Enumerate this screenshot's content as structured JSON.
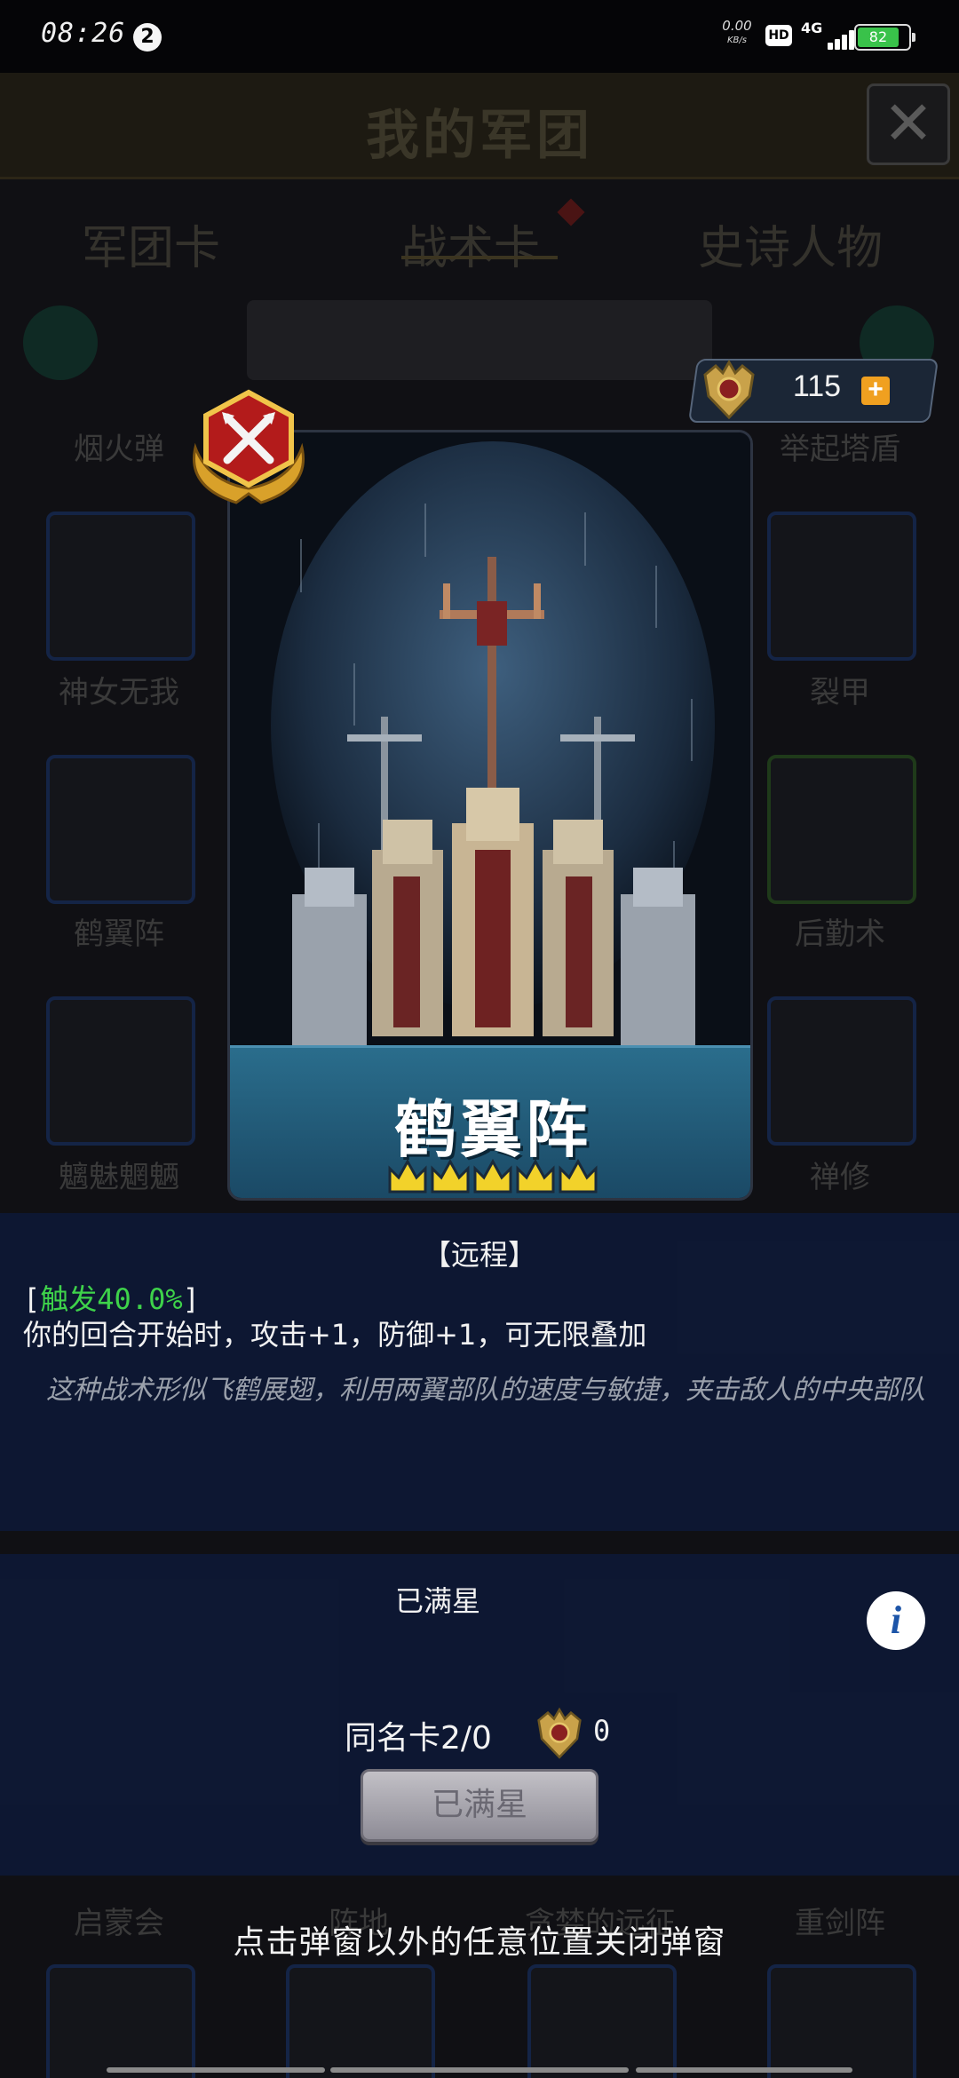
{
  "status_bar": {
    "time": "08:26",
    "notification_count": "2",
    "net_speed": "0.00",
    "net_speed_unit": "KB/s",
    "hd": "HD",
    "network": "4G",
    "battery": "82"
  },
  "background": {
    "title": "我的军团",
    "tabs": [
      "军团卡",
      "战术卡",
      "史诗人物"
    ],
    "cards": {
      "left": [
        "烟火弹",
        "神女无我",
        "鹤翼阵",
        "魑魅魍魉",
        "启蒙会"
      ],
      "right": [
        "举起塔盾",
        "裂甲",
        "后勤术",
        "禅修",
        "重剑阵"
      ],
      "middle": [
        "阵地",
        "贪婪的远征"
      ]
    }
  },
  "currency": {
    "value": "115",
    "plus": "+"
  },
  "card": {
    "name": "鹤翼阵",
    "stars": 5
  },
  "info": {
    "type": "【远程】",
    "trigger_open": "[",
    "trigger_text": "触发40.0%",
    "trigger_close": "]",
    "effect": "你的回合开始时，攻击+1，防御+1，可无限叠加",
    "lore": "这种战术形似飞鹤展翅，利用两翼部队的速度与敏捷，夹击敌人的中央部队"
  },
  "actions": {
    "status": "已满星",
    "duplicate_label": "同名卡2/0",
    "duplicate_count": "0",
    "button_label": "已满星"
  },
  "hint": "点击弹窗以外的任意位置关闭弹窗",
  "colors": {
    "trigger_green": "#3ed24a",
    "panel_bg": "#0e1834",
    "banner_blue": "#2a6d8c",
    "battery_green": "#39c24a",
    "plus_orange": "#f0a020"
  }
}
